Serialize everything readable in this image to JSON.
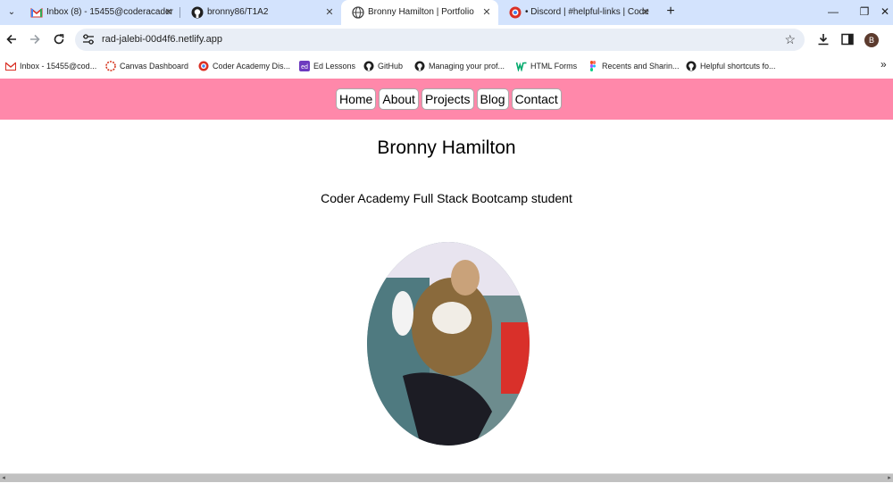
{
  "browser": {
    "tabs": [
      {
        "label": "Inbox (8) - 15455@coderacader",
        "icon": "gmail-icon",
        "active": false
      },
      {
        "label": "bronny86/T1A2",
        "icon": "github-icon",
        "active": false
      },
      {
        "label": "Bronny Hamilton | Portfolio",
        "icon": "globe-icon",
        "active": true
      },
      {
        "label": "• Discord | #helpful-links | Code",
        "icon": "discord-icon",
        "active": false
      }
    ],
    "url": "rad-jalebi-00d4f6.netlify.app",
    "profile_initial": "B",
    "bookmarks": [
      {
        "label": "Inbox - 15455@cod...",
        "icon": "gmail-icon"
      },
      {
        "label": "Canvas Dashboard",
        "icon": "canvas-icon"
      },
      {
        "label": "Coder Academy Dis...",
        "icon": "discord-icon"
      },
      {
        "label": "Ed Lessons",
        "icon": "ed-icon"
      },
      {
        "label": "GitHub",
        "icon": "github-icon"
      },
      {
        "label": "Managing your prof...",
        "icon": "github-icon"
      },
      {
        "label": "HTML Forms",
        "icon": "w3-icon"
      },
      {
        "label": "Recents and Sharin...",
        "icon": "figma-icon"
      },
      {
        "label": "Helpful shortcuts fo...",
        "icon": "github-icon"
      }
    ]
  },
  "site": {
    "nav": [
      "Home",
      "About",
      "Projects",
      "Blog",
      "Contact"
    ],
    "title": "Bronny Hamilton",
    "tagline": "Coder Academy Full Stack Bootcamp student"
  },
  "colors": {
    "nav_bg": "#ff88aa",
    "tabstrip_bg": "#d3e3fd",
    "omnibox_bg": "#e9eef6"
  }
}
